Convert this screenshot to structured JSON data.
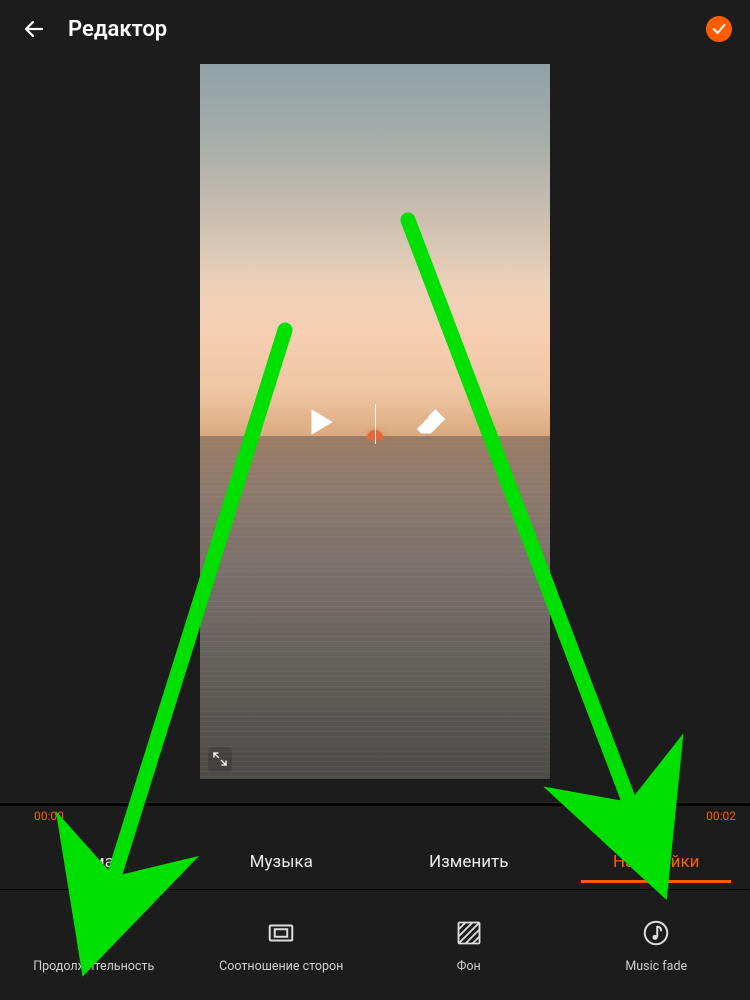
{
  "colors": {
    "accent": "#ff5c00",
    "arrow": "#00E000",
    "bg": "#1c1c1c"
  },
  "header": {
    "title": "Редактор",
    "back_icon": "arrow-left",
    "confirm_icon": "checkmark-circle"
  },
  "preview": {
    "play_icon": "play",
    "erase_icon": "eraser",
    "expand_icon": "expand"
  },
  "timeline": {
    "start": "00:00",
    "end": "00:02"
  },
  "tabs": [
    {
      "id": "theme",
      "label": "Тема",
      "active": false
    },
    {
      "id": "music",
      "label": "Музыка",
      "active": false
    },
    {
      "id": "edit",
      "label": "Изменить",
      "active": false
    },
    {
      "id": "settings",
      "label": "Настройки",
      "active": true
    }
  ],
  "options": [
    {
      "id": "duration",
      "label": "Продолжительность",
      "icon": "clock"
    },
    {
      "id": "ratio",
      "label": "Соотношение сторон",
      "icon": "aspect-ratio"
    },
    {
      "id": "bg",
      "label": "Фон",
      "icon": "background"
    },
    {
      "id": "fade",
      "label": "Music fade",
      "icon": "music-fade"
    }
  ],
  "annotations": {
    "arrow_to_settings_tab": true,
    "arrow_to_duration_option": true
  }
}
